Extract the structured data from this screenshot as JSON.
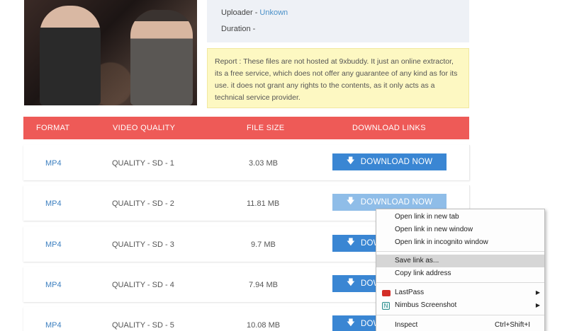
{
  "video": {
    "uploader_label": "Uploader - ",
    "uploader_value": "Unkown",
    "duration_label": "Duration -"
  },
  "report": "Report : These files are not hosted at 9xbuddy. It just an online extractor, its a free service, which does not offer any guarantee of any kind as for its use. it does not grant any rights to the contents, as it only acts as a technical service provider.",
  "table": {
    "headers": [
      "FORMAT",
      "VIDEO QUALITY",
      "FILE SIZE",
      "DOWNLOAD LINKS"
    ],
    "rows": [
      {
        "format": "MP4",
        "quality": "QUALITY - SD - 1",
        "size": "3.03 MB",
        "button": "DOWNLOAD NOW"
      },
      {
        "format": "MP4",
        "quality": "QUALITY - SD - 2",
        "size": "11.81 MB",
        "button": "DOWNLOAD NOW"
      },
      {
        "format": "MP4",
        "quality": "QUALITY - SD - 3",
        "size": "9.7 MB",
        "button": "DOW"
      },
      {
        "format": "MP4",
        "quality": "QUALITY - SD - 4",
        "size": "7.94 MB",
        "button": "DOW"
      },
      {
        "format": "MP4",
        "quality": "QUALITY - SD - 5",
        "size": "10.08 MB",
        "button": "DOW"
      }
    ]
  },
  "context_menu": {
    "items": [
      {
        "label": "Open link in new tab"
      },
      {
        "label": "Open link in new window"
      },
      {
        "label": "Open link in incognito window"
      },
      {
        "label": "Save link as..."
      },
      {
        "label": "Copy link address"
      },
      {
        "label": "LastPass"
      },
      {
        "label": "Nimbus Screenshot"
      },
      {
        "label": "Inspect",
        "shortcut": "Ctrl+Shift+I"
      }
    ]
  },
  "colors": {
    "header_bg": "#ee5a57",
    "button_bg": "#3a86d3",
    "link": "#3e80c0",
    "report_bg": "#fdf8c2"
  }
}
